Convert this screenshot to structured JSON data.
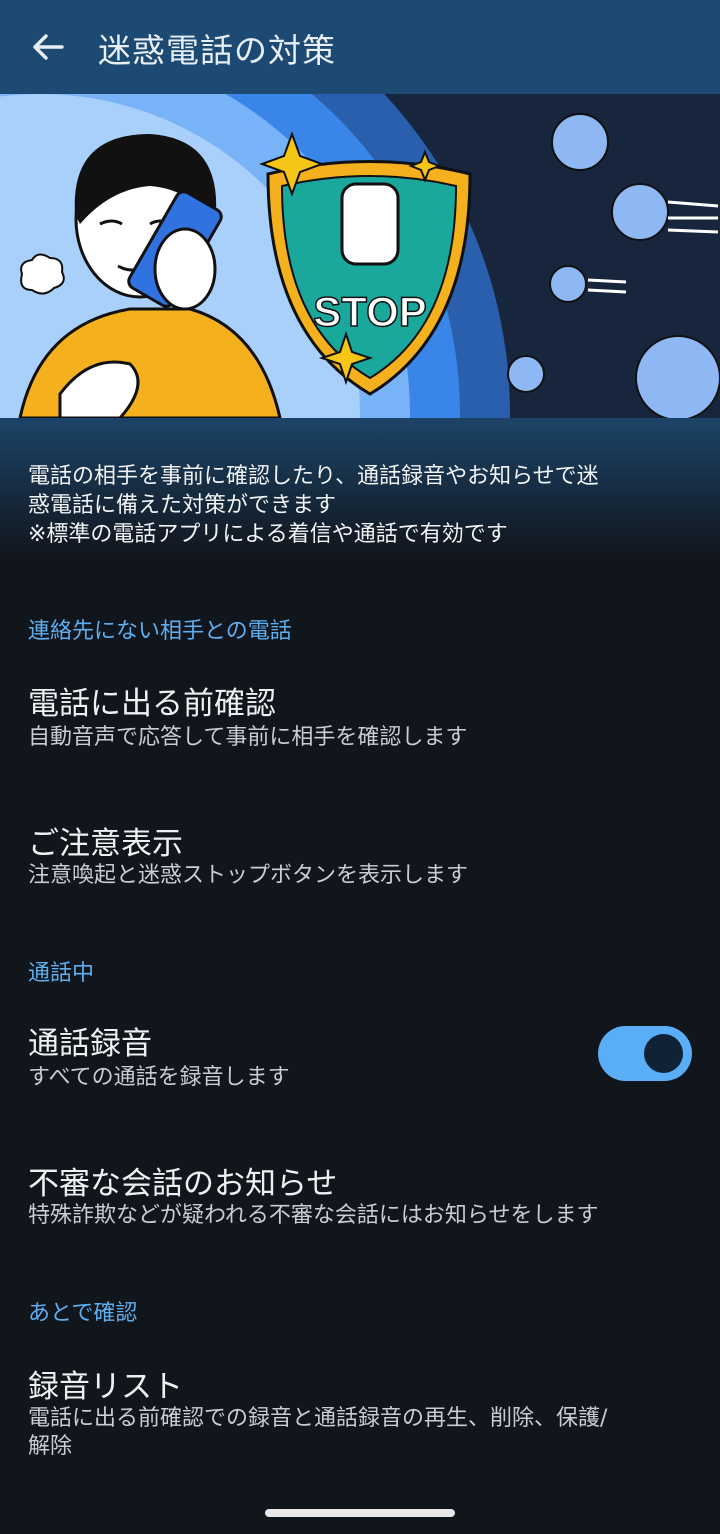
{
  "appbar": {
    "title": "迷惑電話の対策",
    "back_icon": "arrow-left-icon"
  },
  "hero": {
    "stop_text": "STOP"
  },
  "description": "電話の相手を事前に確認したり、通話録音やお知らせで迷\n惑電話に備えた対策ができます\n※標準の電話アプリによる着信や通話で有効です",
  "sections": {
    "unknown": "連絡先にない相手との電話",
    "in_call": "通話中",
    "later": "あとで確認"
  },
  "items": {
    "pre_check": {
      "title": "電話に出る前確認",
      "subtitle": "自動音声で応答して事前に相手を確認します"
    },
    "caution": {
      "title": "ご注意表示",
      "subtitle": "注意喚起と迷惑ストップボタンを表示します"
    },
    "recording": {
      "title": "通話録音",
      "subtitle": "すべての通話を録音します",
      "enabled": true
    },
    "suspicious": {
      "title": "不審な会話のお知らせ",
      "subtitle": "特殊詐欺などが疑われる不審な会話にはお知らせをします"
    },
    "record_list": {
      "title": "録音リスト",
      "subtitle": "電話に出る前確認での録音と通話録音の再生、削除、保護/\n解除"
    }
  },
  "colors": {
    "appbar": "#1d4a72",
    "background": "#11151c",
    "accent": "#5eaef0",
    "toggle_on": "#5aaef5"
  }
}
